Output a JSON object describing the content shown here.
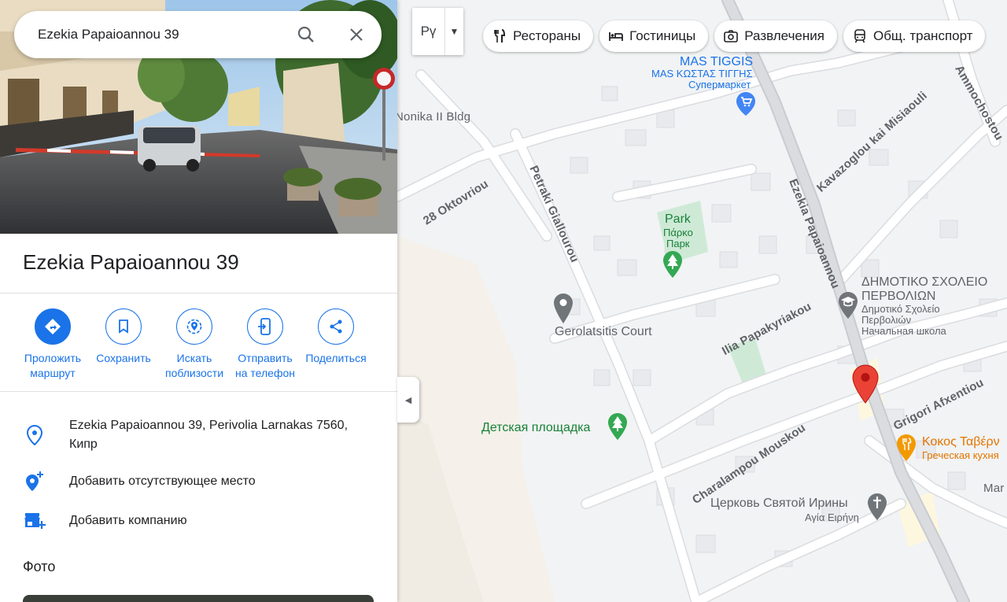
{
  "search": {
    "query": "Ezekia Papaioannou 39"
  },
  "place": {
    "title": "Ezekia Papaioannou 39"
  },
  "actions": [
    {
      "label": "Проложить\nмаршрут",
      "icon": "directions-icon"
    },
    {
      "label": "Сохранить",
      "icon": "bookmark-icon"
    },
    {
      "label": "Искать\nпоблизости",
      "icon": "nearby-icon"
    },
    {
      "label": "Отправить\nна телефон",
      "icon": "send-to-phone-icon"
    },
    {
      "label": "Поделиться",
      "icon": "share-icon"
    }
  ],
  "info": {
    "address": "Ezekia Papaioannou 39, Perivolia Larnakas 7560,\nКипр",
    "add_missing_place": "Добавить отсутствующее место",
    "add_business": "Добавить компанию"
  },
  "photos": {
    "title": "Фото"
  },
  "map_type": {
    "label": "Рү"
  },
  "chips": [
    {
      "label": "Рестораны",
      "icon": "restaurant-icon"
    },
    {
      "label": "Гостиницы",
      "icon": "hotel-icon"
    },
    {
      "label": "Развлечения",
      "icon": "camera-icon"
    },
    {
      "label": "Общ. транспорт",
      "icon": "transit-icon"
    }
  ],
  "map": {
    "streets": {
      "nonika": "Nonika II Bldg",
      "oktovriou": "28 Oktovriou",
      "petraki": "Petraki Giallourou",
      "ezekia": "Ezekia Papaioannou",
      "kavazoglou": "Kavazoglou kai Misiaouli",
      "ammochostou": "Ammochostou",
      "ilia": "Ilia Papakyriakou",
      "grigori": "Grigori Afxentiou",
      "charalampou": "Charalampou Mouskou",
      "mar": "Mar"
    },
    "pois": {
      "mas_tiggis": "MAS TIGGIS",
      "mas_tiggis_gr": "MAS ΚΩΣΤΑΣ ΤΙΓΓΗΣ",
      "mas_tiggis_type": "Супермаркет",
      "park": "Park",
      "park_gr": "Πάρκο",
      "park_ru": "Парк",
      "gerolatsitis": "Gerolatsitis Court",
      "school": "ΔΗΜΟΤΙΚΟ ΣΧΟΛΕΙΟ",
      "school2": "ΠΕΡΒΟΛΙΩΝ",
      "school_gr1": "Δημοτικό Σχολείο",
      "school_gr2": "Περβολιών",
      "school_type": "Начальная школа",
      "playground": "Детская площадка",
      "kokos": "Κοκος Ταβέρν",
      "kokos_type": "Греческая кухня",
      "church": "Церковь Святой Ирины",
      "church_gr": "Αγία Ειρήνη"
    }
  },
  "colors": {
    "accent": "#1a73e8",
    "pin_red": "#d93025",
    "poi_green": "#188038",
    "poi_gray": "#5f6368",
    "poi_orange": "#e37400",
    "supermarket_blue": "#4285f4"
  }
}
